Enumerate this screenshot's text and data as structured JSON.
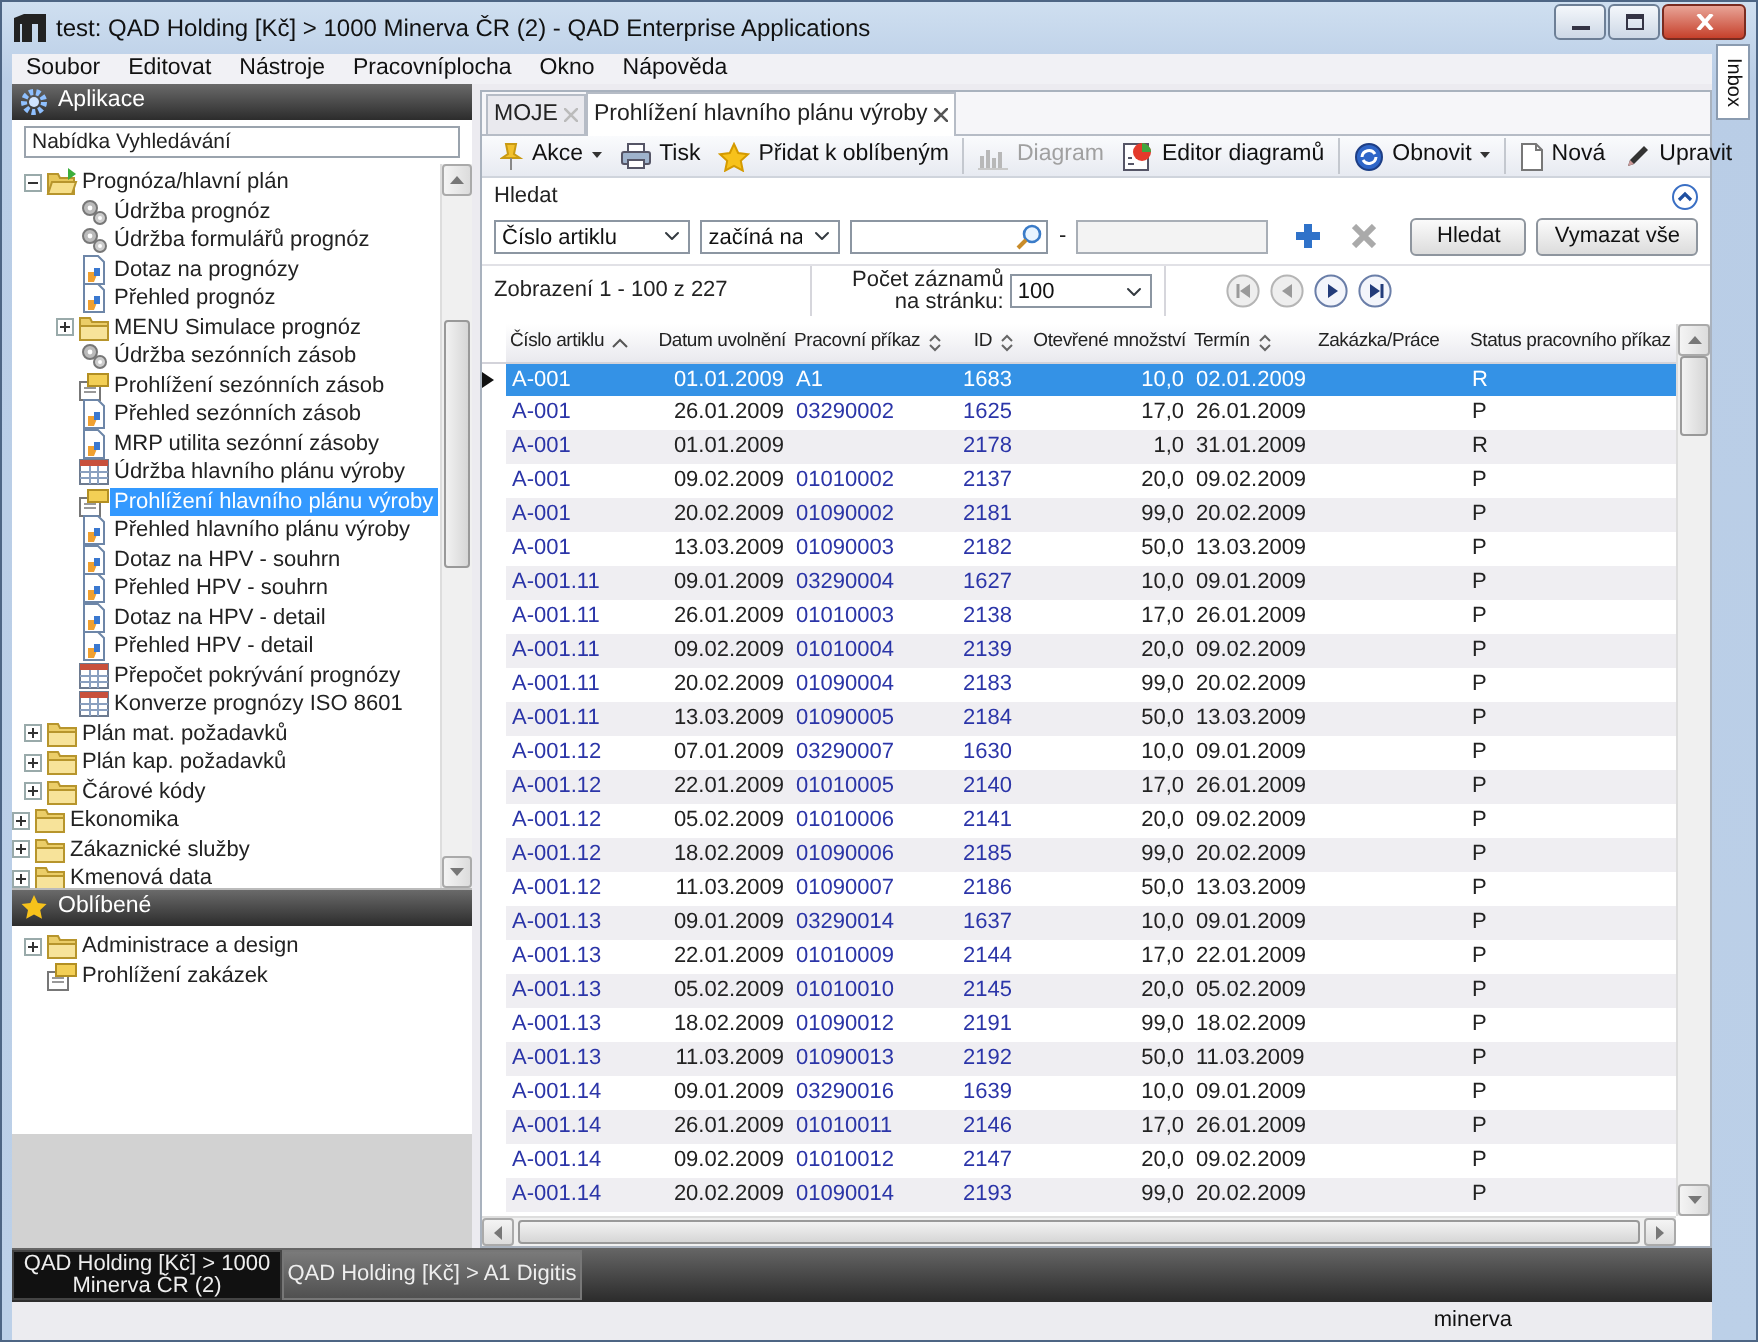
{
  "window": {
    "title": "test: QAD Holding [Kč] > 1000 Minerva ČR (2) - QAD Enterprise Applications"
  },
  "menu": [
    "Soubor",
    "Editovat",
    "Nástroje",
    "Pracovníplocha",
    "Okno",
    "Nápověda"
  ],
  "side_tab": {
    "label": "Inbox"
  },
  "sidebar": {
    "header": "Aplikace",
    "search": {
      "value": "Nabídka Vyhledávání"
    },
    "tree": [
      {
        "children": [
          {
            "label": "Prognóza/hlavní plán",
            "kind": "folder",
            "expanded": true,
            "selected": false,
            "children": [
              {
                "label": "Údržba prognóz",
                "kind": "gears",
                "selected": false
              },
              {
                "label": "Údržba formulářů prognóz",
                "kind": "gears",
                "selected": false
              },
              {
                "label": "Dotaz na prognózy",
                "kind": "report",
                "selected": false
              },
              {
                "label": "Přehled prognóz",
                "kind": "report",
                "selected": false
              },
              {
                "label": "MENU Simulace prognóz",
                "kind": "folder",
                "expanded": false,
                "selected": false
              },
              {
                "label": "Údržba sezónních zásob",
                "kind": "gears",
                "selected": false
              },
              {
                "label": "Prohlížení sezónních zásob",
                "kind": "browse",
                "selected": false
              },
              {
                "label": "Přehled sezónních zásob",
                "kind": "report",
                "selected": false
              },
              {
                "label": "MRP utilita sezónní zásoby",
                "kind": "report",
                "selected": false
              },
              {
                "label": "Údržba hlavního plánu výroby",
                "kind": "table",
                "selected": false
              },
              {
                "label": "Prohlížení hlavního plánu výroby",
                "kind": "browse",
                "selected": true
              },
              {
                "label": "Přehled hlavního plánu výroby",
                "kind": "report",
                "selected": false
              },
              {
                "label": "Dotaz na HPV - souhrn",
                "kind": "report",
                "selected": false
              },
              {
                "label": "Přehled HPV - souhrn",
                "kind": "report",
                "selected": false
              },
              {
                "label": "Dotaz na HPV - detail",
                "kind": "report",
                "selected": false
              },
              {
                "label": "Přehled HPV - detail",
                "kind": "report",
                "selected": false
              },
              {
                "label": "Přepočet pokrývání prognózy",
                "kind": "table",
                "selected": false
              },
              {
                "label": "Konverze prognózy ISO 8601",
                "kind": "table",
                "selected": false
              }
            ]
          },
          {
            "label": "Plán mat. požadavků",
            "kind": "folder",
            "expanded": false,
            "selected": false
          },
          {
            "label": "Plán kap. požadavků",
            "kind": "folder",
            "expanded": false,
            "selected": false
          },
          {
            "label": "Čárové kódy",
            "kind": "folder",
            "expanded": false,
            "selected": false
          }
        ]
      },
      {
        "label": "Ekonomika",
        "kind": "folder",
        "expanded": false,
        "selected": false
      },
      {
        "label": "Zákaznické služby",
        "kind": "folder",
        "expanded": false,
        "selected": false
      },
      {
        "label": "Kmenová data",
        "kind": "folder",
        "expanded": false,
        "selected": false
      }
    ],
    "favorites": {
      "header": "Oblíbené",
      "items": [
        {
          "label": "Administrace a design",
          "kind": "folder",
          "expanded": false,
          "selected": false
        },
        {
          "label": "Prohlížení zakázek",
          "kind": "browse",
          "selected": false
        }
      ]
    }
  },
  "tabs": [
    {
      "label": "MOJE",
      "selected": false
    },
    {
      "label": "Prohlížení hlavního plánu výroby",
      "selected": true
    }
  ],
  "toolbar": [
    [
      {
        "label": "Akce",
        "dropdown": true,
        "disabled": false
      },
      {
        "label": "Tisk",
        "dropdown": false,
        "disabled": false
      },
      {
        "label": "Přidat k oblíbeným",
        "dropdown": false,
        "disabled": false
      }
    ],
    [
      {
        "label": "Diagram",
        "dropdown": false,
        "disabled": true
      },
      {
        "label": "Editor diagramů",
        "dropdown": false,
        "disabled": false
      }
    ],
    [
      {
        "label": "Obnovit",
        "dropdown": true,
        "disabled": false
      }
    ],
    [
      {
        "label": "Nová",
        "dropdown": false,
        "disabled": false
      },
      {
        "label": "Upravit",
        "dropdown": false,
        "disabled": false
      }
    ]
  ],
  "search_panel": {
    "title": "Hledat",
    "field": "Číslo artiklu",
    "operator": "začíná na",
    "separator": "-",
    "buttons": [
      "Hledat",
      "Vymazat vše"
    ]
  },
  "pager": {
    "summary": "Zobrazení 1 - 100 z 227",
    "page_size_label": [
      "Počet záznamů",
      "na stránku:"
    ],
    "page_size": "100",
    "nav": [
      {
        "kind": "first",
        "disabled": true
      },
      {
        "kind": "prev",
        "disabled": true
      },
      {
        "kind": "next",
        "disabled": false
      },
      {
        "kind": "last",
        "disabled": false
      }
    ]
  },
  "table": {
    "columns": [
      {
        "label": "Číslo artiklu",
        "sortable": true,
        "sorted": true
      },
      {
        "label": "Datum uvolnění",
        "sortable": false,
        "sorted": false
      },
      {
        "label": "Pracovní příkaz",
        "sortable": true,
        "sorted": false
      },
      {
        "label": "ID",
        "sortable": true,
        "sorted": false
      },
      {
        "label": "Otevřené množství",
        "sortable": false,
        "sorted": false
      },
      {
        "label": "Termín",
        "sortable": true,
        "sorted": false
      },
      {
        "label": "Zakázka/Práce",
        "sortable": false,
        "sorted": false
      },
      {
        "label": "Status pracovního příkaz"
      }
    ],
    "rows": [
      {
        "selected": true,
        "cells": [
          "A-001",
          "01.01.2009",
          "A1",
          "1683",
          "10,0",
          "02.01.2009",
          "",
          "R"
        ]
      },
      {
        "selected": false,
        "cells": [
          "A-001",
          "26.01.2009",
          "03290002",
          "1625",
          "17,0",
          "26.01.2009",
          "",
          "P"
        ]
      },
      {
        "selected": false,
        "cells": [
          "A-001",
          "01.01.2009",
          "",
          "2178",
          "1,0",
          "31.01.2009",
          "",
          "R"
        ]
      },
      {
        "selected": false,
        "cells": [
          "A-001",
          "09.02.2009",
          "01010002",
          "2137",
          "20,0",
          "09.02.2009",
          "",
          "P"
        ]
      },
      {
        "selected": false,
        "cells": [
          "A-001",
          "20.02.2009",
          "01090002",
          "2181",
          "99,0",
          "20.02.2009",
          "",
          "P"
        ]
      },
      {
        "selected": false,
        "cells": [
          "A-001",
          "13.03.2009",
          "01090003",
          "2182",
          "50,0",
          "13.03.2009",
          "",
          "P"
        ]
      },
      {
        "selected": false,
        "cells": [
          "A-001.11",
          "09.01.2009",
          "03290004",
          "1627",
          "10,0",
          "09.01.2009",
          "",
          "P"
        ]
      },
      {
        "selected": false,
        "cells": [
          "A-001.11",
          "26.01.2009",
          "01010003",
          "2138",
          "17,0",
          "26.01.2009",
          "",
          "P"
        ]
      },
      {
        "selected": false,
        "cells": [
          "A-001.11",
          "09.02.2009",
          "01010004",
          "2139",
          "20,0",
          "09.02.2009",
          "",
          "P"
        ]
      },
      {
        "selected": false,
        "cells": [
          "A-001.11",
          "20.02.2009",
          "01090004",
          "2183",
          "99,0",
          "20.02.2009",
          "",
          "P"
        ]
      },
      {
        "selected": false,
        "cells": [
          "A-001.11",
          "13.03.2009",
          "01090005",
          "2184",
          "50,0",
          "13.03.2009",
          "",
          "P"
        ]
      },
      {
        "selected": false,
        "cells": [
          "A-001.12",
          "07.01.2009",
          "03290007",
          "1630",
          "10,0",
          "09.01.2009",
          "",
          "P"
        ]
      },
      {
        "selected": false,
        "cells": [
          "A-001.12",
          "22.01.2009",
          "01010005",
          "2140",
          "17,0",
          "26.01.2009",
          "",
          "P"
        ]
      },
      {
        "selected": false,
        "cells": [
          "A-001.12",
          "05.02.2009",
          "01010006",
          "2141",
          "20,0",
          "09.02.2009",
          "",
          "P"
        ]
      },
      {
        "selected": false,
        "cells": [
          "A-001.12",
          "18.02.2009",
          "01090006",
          "2185",
          "99,0",
          "20.02.2009",
          "",
          "P"
        ]
      },
      {
        "selected": false,
        "cells": [
          "A-001.12",
          "11.03.2009",
          "01090007",
          "2186",
          "50,0",
          "13.03.2009",
          "",
          "P"
        ]
      },
      {
        "selected": false,
        "cells": [
          "A-001.13",
          "09.01.2009",
          "03290014",
          "1637",
          "10,0",
          "09.01.2009",
          "",
          "P"
        ]
      },
      {
        "selected": false,
        "cells": [
          "A-001.13",
          "22.01.2009",
          "01010009",
          "2144",
          "17,0",
          "22.01.2009",
          "",
          "P"
        ]
      },
      {
        "selected": false,
        "cells": [
          "A-001.13",
          "05.02.2009",
          "01010010",
          "2145",
          "20,0",
          "05.02.2009",
          "",
          "P"
        ]
      },
      {
        "selected": false,
        "cells": [
          "A-001.13",
          "18.02.2009",
          "01090012",
          "2191",
          "99,0",
          "18.02.2009",
          "",
          "P"
        ]
      },
      {
        "selected": false,
        "cells": [
          "A-001.13",
          "11.03.2009",
          "01090013",
          "2192",
          "50,0",
          "11.03.2009",
          "",
          "P"
        ]
      },
      {
        "selected": false,
        "cells": [
          "A-001.14",
          "09.01.2009",
          "03290016",
          "1639",
          "10,0",
          "09.01.2009",
          "",
          "P"
        ]
      },
      {
        "selected": false,
        "cells": [
          "A-001.14",
          "26.01.2009",
          "01010011",
          "2146",
          "17,0",
          "26.01.2009",
          "",
          "P"
        ]
      },
      {
        "selected": false,
        "cells": [
          "A-001.14",
          "09.02.2009",
          "01010012",
          "2147",
          "20,0",
          "09.02.2009",
          "",
          "P"
        ]
      },
      {
        "selected": false,
        "cells": [
          "A-001.14",
          "20.02.2009",
          "01090014",
          "2193",
          "99,0",
          "20.02.2009",
          "",
          "P"
        ]
      }
    ]
  },
  "bottom_tabs": [
    {
      "label": "QAD Holding [Kč] > 1000 Minerva ČR (2)",
      "selected": true
    },
    {
      "label": "QAD Holding [Kč] > A1 Digitis",
      "selected": false
    }
  ],
  "status_bar": {
    "user": "minerva"
  }
}
